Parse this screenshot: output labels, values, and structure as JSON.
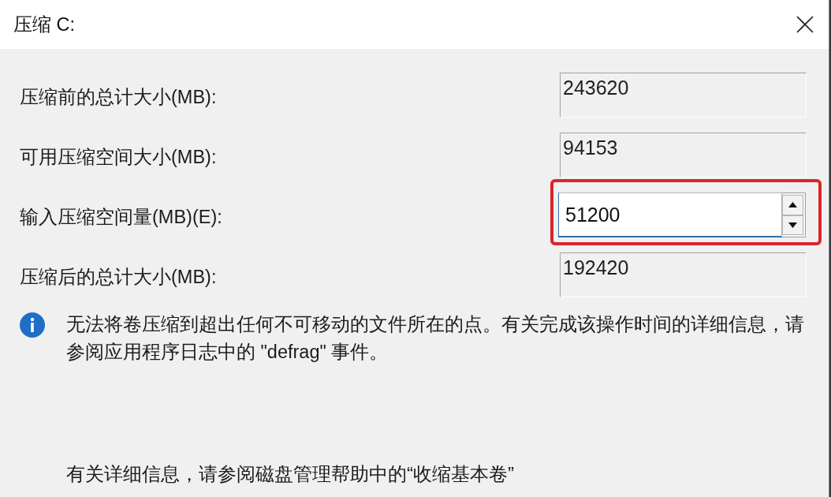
{
  "window": {
    "title": "压缩 C:"
  },
  "fields": [
    {
      "kind": "readonly",
      "label": "压缩前的总计大小(MB):",
      "value": "243620",
      "highlighted": false
    },
    {
      "kind": "readonly",
      "label": "可用压缩空间大小(MB):",
      "value": "94153",
      "highlighted": false
    },
    {
      "kind": "spinner",
      "label": "输入压缩空间量(MB)(E):",
      "value": "51200",
      "highlighted": true
    },
    {
      "kind": "readonly",
      "label": "压缩后的总计大小(MB):",
      "value": "192420",
      "highlighted": false
    }
  ],
  "info": {
    "text": "无法将卷压缩到超出任何不可移动的文件所在的点。有关完成该操作时间的详细信息，请参阅应用程序日志中的 \"defrag\" 事件。"
  },
  "help_text": "有关详细信息，请参阅磁盘管理帮助中的“收缩基本卷”"
}
